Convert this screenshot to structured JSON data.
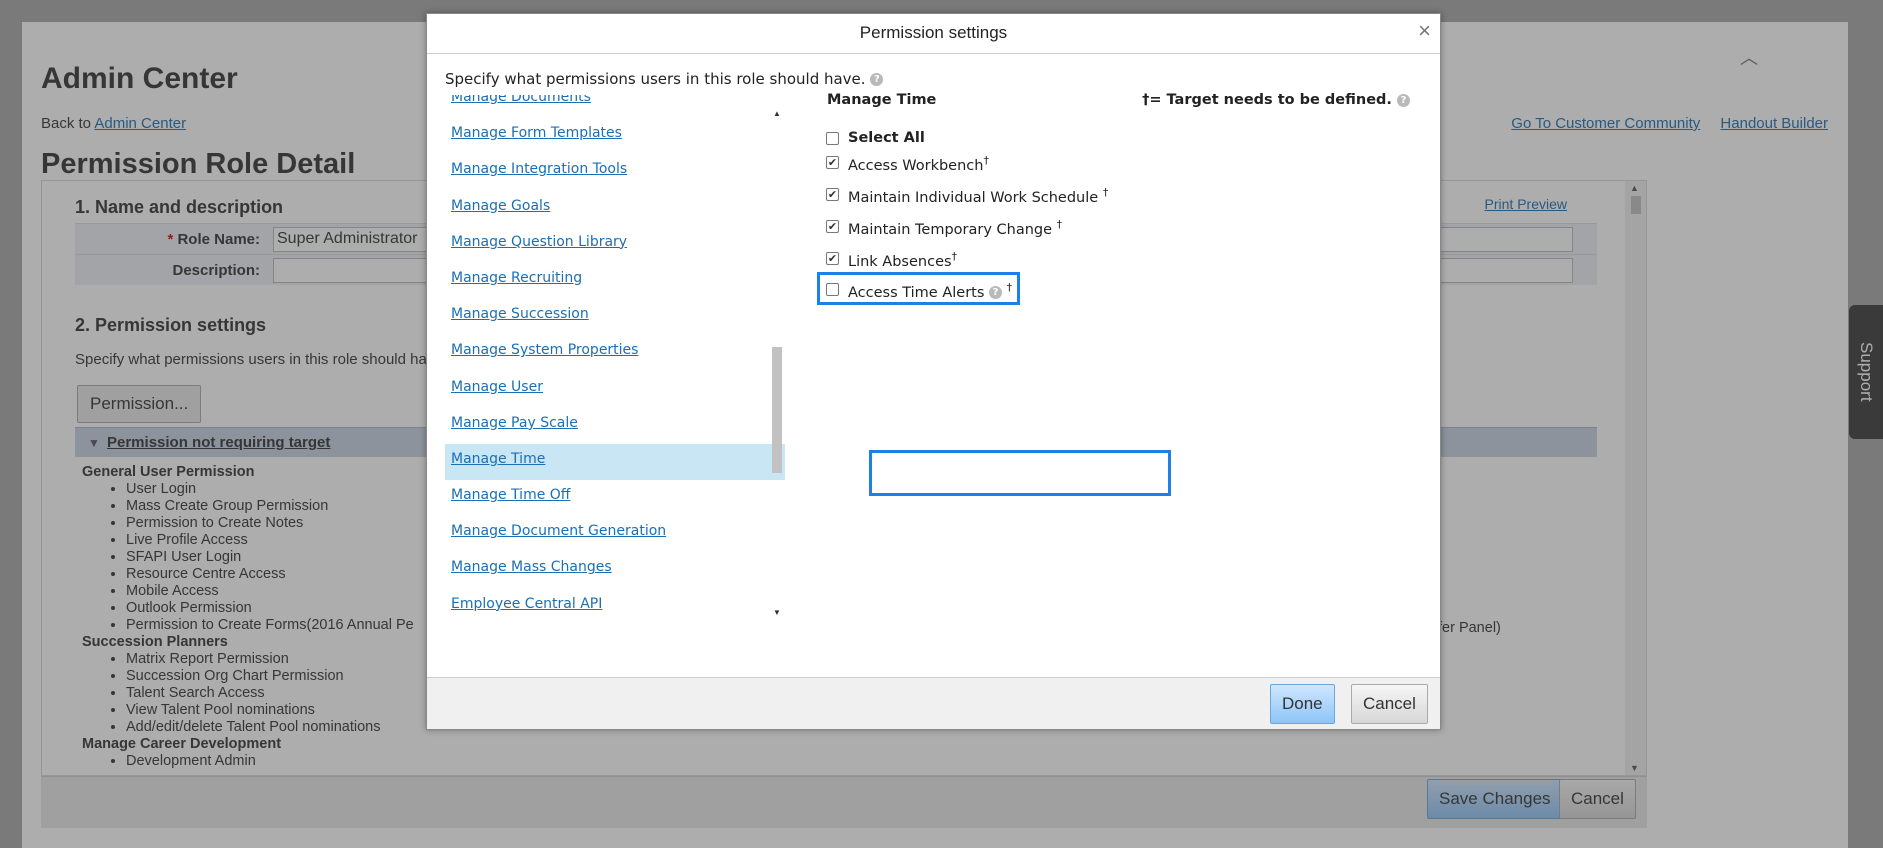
{
  "background": {
    "page_title": "Admin Center",
    "back_prefix": "Back to",
    "back_link": "Admin Center",
    "top_links": [
      "Go To Customer Community",
      "Handout Builder"
    ],
    "section_title": "Permission Role Detail",
    "print_preview": "Print Preview",
    "name_section": "1. Name and description",
    "role_name_label": "Role Name:",
    "role_name_value": "Super Administrator",
    "description_label": "Description:",
    "perm_section": "2. Permission settings",
    "perm_desc": "Specify what permissions users in this role should hav",
    "permission_button": "Permission...",
    "perm_header": "Permission not requiring target",
    "groups": [
      {
        "name": "General User Permission",
        "items": [
          "User Login",
          "Mass Create Group Permission",
          "Permission to Create Notes",
          "Live Profile Access",
          "SFAPI User Login",
          "Resource Centre Access",
          "Mobile Access",
          "Outlook Permission",
          "Permission to Create Forms(2016 Annual Pe"
        ]
      },
      {
        "name": "Succession Planners",
        "items": [
          "Matrix Report Permission",
          "Succession Org Chart Permission",
          "Talent Search Access",
          "View Talent Pool nominations",
          "Add/edit/delete Talent Pool nominations"
        ]
      },
      {
        "name": "Manage Career Development",
        "items": [
          "Development Admin"
        ]
      }
    ],
    "overflow_text": "fer Panel)",
    "save_button": "Save Changes",
    "cancel_button": "Cancel",
    "support_tab": "Support"
  },
  "modal": {
    "title": "Permission settings",
    "close": "×",
    "intro": "Specify what permissions users in this role should have.",
    "categories": [
      "Manage Documents",
      "Manage Form Templates",
      "Manage Integration Tools",
      "Manage Goals",
      "Manage Question Library",
      "Manage Recruiting",
      "Manage Succession",
      "Manage System Properties",
      "Manage User",
      "Manage Pay Scale",
      "Manage Time",
      "Manage Time Off",
      "Manage Document Generation",
      "Manage Mass Changes",
      "Employee Central API"
    ],
    "selected_category": "Manage Time",
    "panel_title": "Manage Time",
    "target_note": "†= Target needs to be defined.",
    "select_all": "Select All",
    "permissions": [
      {
        "label": "Access Workbench",
        "checked": true
      },
      {
        "label": "Maintain Individual Work Schedule",
        "checked": true
      },
      {
        "label": "Maintain Temporary Change",
        "checked": true
      },
      {
        "label": "Link Absences",
        "checked": true
      },
      {
        "label": "Access Time Alerts",
        "checked": false
      }
    ],
    "dagger": "†",
    "done_button": "Done",
    "cancel_button": "Cancel"
  }
}
